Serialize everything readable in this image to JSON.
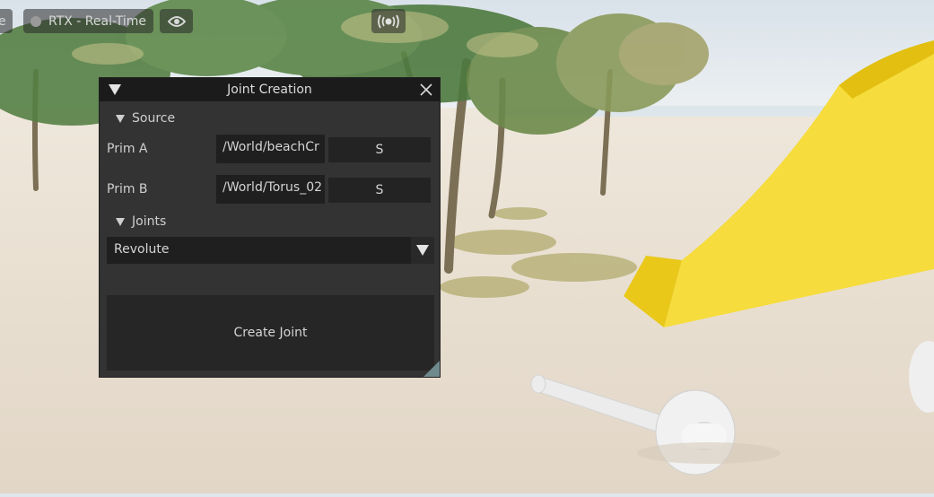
{
  "toolbar": {
    "left_text": "e",
    "renderer_label": "RTX - Real-Time",
    "eye_icon": "eye-icon",
    "live_icon": "broadcast-icon"
  },
  "window": {
    "title": "Joint Creation",
    "source_section": {
      "label": "Source",
      "prim_a": {
        "label": "Prim A",
        "value": "/World/beachCr",
        "select_label": "S"
      },
      "prim_b": {
        "label": "Prim B",
        "value": "/World/Torus_02",
        "select_label": "S"
      }
    },
    "joints_section": {
      "label": "Joints",
      "selected": "Revolute"
    },
    "create_button_label": "Create Joint"
  },
  "colors": {
    "window_bg": "#333333",
    "title_bg": "#1b1b1b",
    "field_bg": "#1f1f1f",
    "sand": "#e9e1d5",
    "yellow_object": "#f3d633"
  }
}
